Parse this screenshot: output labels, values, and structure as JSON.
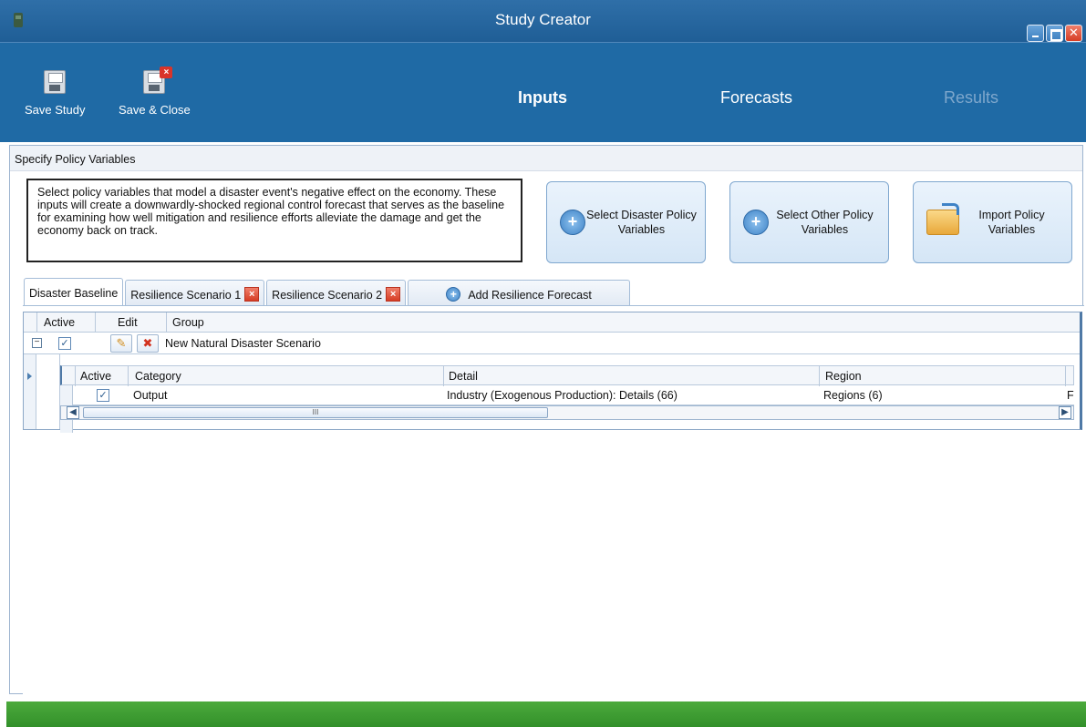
{
  "window": {
    "title": "Study Creator"
  },
  "ribbon": {
    "save_study": "Save Study",
    "save_close": "Save & Close",
    "tabs": [
      {
        "label": "Inputs",
        "state": "active"
      },
      {
        "label": "Forecasts",
        "state": "normal"
      },
      {
        "label": "Results",
        "state": "disabled"
      }
    ]
  },
  "section": {
    "header": "Specify Policy Variables",
    "description": "Select policy variables that model a disaster event's negative effect on the economy. These inputs will create a downwardly-shocked regional control forecast that serves as the baseline for examining how well mitigation and resilience efforts alleviate the damage and get the economy back on track.",
    "buttons": {
      "disaster": "Select Disaster Policy Variables",
      "other": "Select Other Policy Variables",
      "import": "Import Policy Variables"
    }
  },
  "tabs": {
    "items": [
      "Disaster Baseline",
      "Resilience Scenario 1",
      "Resilience Scenario 2"
    ],
    "add_label": "Add Resilience Forecast",
    "active_index": 0
  },
  "grid": {
    "headers": {
      "active": "Active",
      "edit": "Edit",
      "group": "Group"
    },
    "group_row": {
      "name": "New Natural Disaster Scenario",
      "active": true,
      "expanded": true
    },
    "sub_headers": {
      "active": "Active",
      "category": "Category",
      "detail": "Detail",
      "region": "Region"
    },
    "sub_rows": [
      {
        "active": true,
        "category": "Output",
        "detail": "Industry (Exogenous Production): Details (66)",
        "region": "Regions (6)",
        "trailing": "F"
      }
    ],
    "scroll_thumb_glyph": "III"
  },
  "colors": {
    "ribbon": "#1f6aa5",
    "titlebar": "#2f6fa8",
    "status": "#3a9a2f"
  },
  "icons": [
    "save-icon",
    "save-close-icon",
    "plus-circle-icon",
    "folder-import-icon",
    "close-tab-icon",
    "pencil-icon",
    "delete-icon",
    "checkbox-icon",
    "collapse-icon"
  ]
}
